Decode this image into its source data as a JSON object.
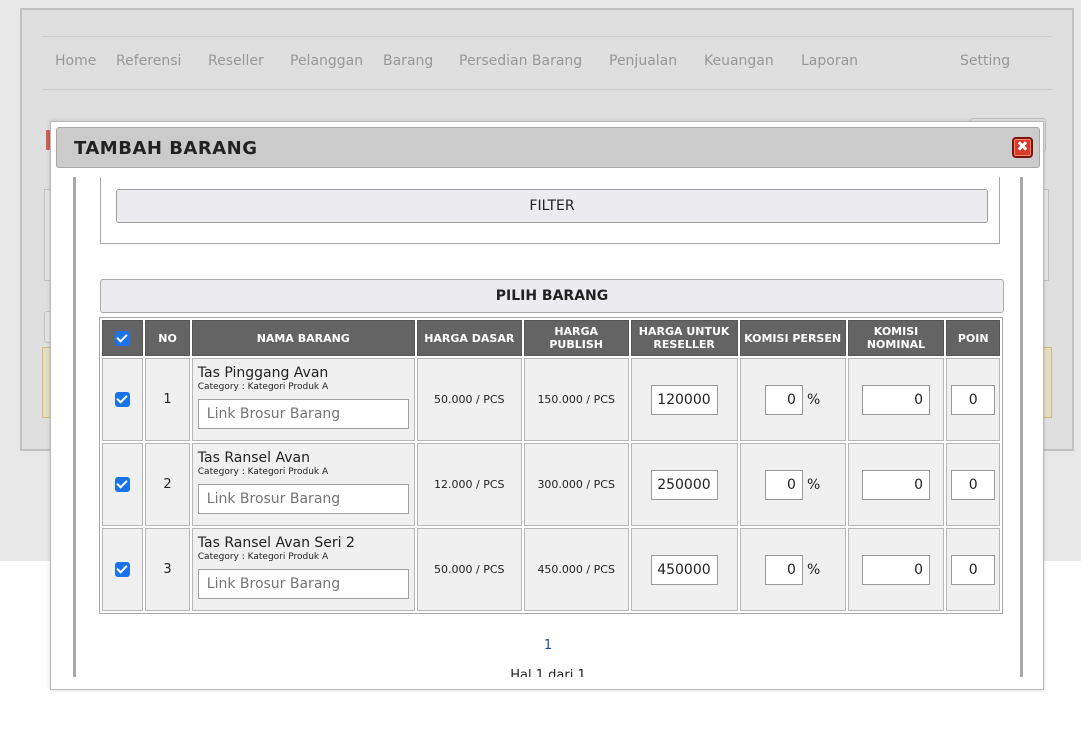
{
  "nav": {
    "items": [
      "Home",
      "Referensi",
      "Reseller",
      "Pelanggan",
      "Barang",
      "Persedian Barang",
      "Penjualan",
      "Keuangan",
      "Laporan",
      "Setting"
    ]
  },
  "modal": {
    "title": "TAMBAH BARANG",
    "close_icon": "close-icon",
    "filter_label": "FILTER",
    "section_title": "PILIH BARANG"
  },
  "table": {
    "headers": {
      "no": "NO",
      "nama": "NAMA BARANG",
      "harga_dasar": "HARGA DASAR",
      "harga_publish": "HARGA PUBLISH",
      "harga_reseller": "HARGA UNTUK RESELLER",
      "komisi_persen": "KOMISI PERSEN",
      "komisi_nominal": "KOMISI NOMINAL",
      "poin": "POIN"
    },
    "link_placeholder": "Link Brosur Barang",
    "percent_sign": "%",
    "rows": [
      {
        "no": "1",
        "name": "Tas Pinggang Avan",
        "category": "Category : Kategori Produk A",
        "harga_dasar": "50.000 / PCS",
        "harga_publish": "150.000 / PCS",
        "harga_reseller": "120000",
        "komisi_persen": "0",
        "komisi_nominal": "0",
        "poin": "0",
        "checked": true
      },
      {
        "no": "2",
        "name": "Tas Ransel Avan",
        "category": "Category : Kategori Produk A",
        "harga_dasar": "12.000 / PCS",
        "harga_publish": "300.000 / PCS",
        "harga_reseller": "250000",
        "komisi_persen": "0",
        "komisi_nominal": "0",
        "poin": "0",
        "checked": true
      },
      {
        "no": "3",
        "name": "Tas Ransel Avan Seri 2",
        "category": "Category : Kategori Produk A",
        "harga_dasar": "50.000 / PCS",
        "harga_publish": "450.000 / PCS",
        "harga_reseller": "450000",
        "komisi_persen": "0",
        "komisi_nominal": "0",
        "poin": "0",
        "checked": true
      }
    ]
  },
  "pagination": {
    "current_page": "1",
    "info": "Hal 1 dari 1"
  },
  "colors": {
    "header_bg": "#646464",
    "checkbox": "#1a73e8",
    "close_button": "#d93a28",
    "page_link": "#1a4bb8"
  }
}
